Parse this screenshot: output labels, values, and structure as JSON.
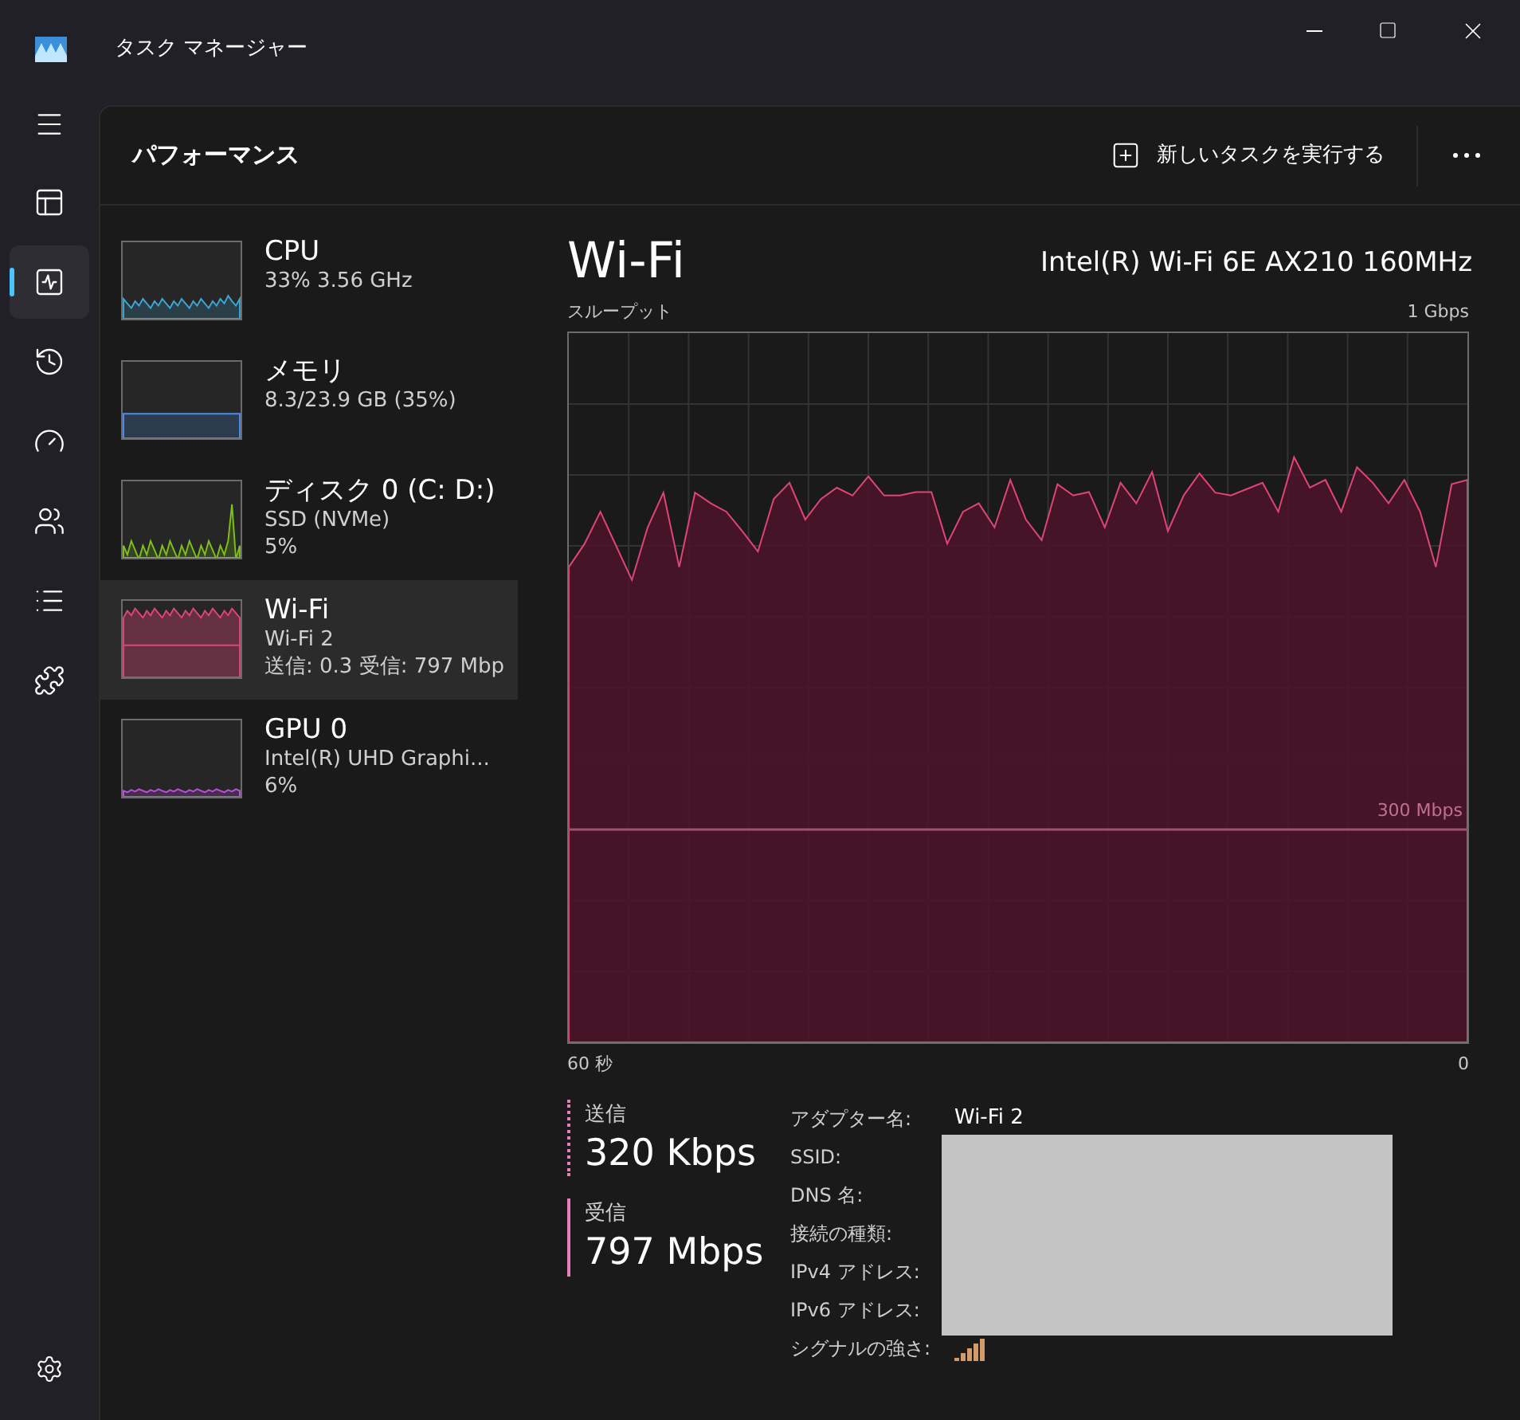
{
  "window": {
    "title": "タスク マネージャー"
  },
  "nav": [
    {
      "kind": "processes",
      "selected": false
    },
    {
      "kind": "performance",
      "selected": true
    },
    {
      "kind": "history",
      "selected": false
    },
    {
      "kind": "startup",
      "selected": false
    },
    {
      "kind": "users",
      "selected": false
    },
    {
      "kind": "details",
      "selected": false
    },
    {
      "kind": "services",
      "selected": false
    }
  ],
  "page": {
    "title": "パフォーマンス",
    "run_task": "新しいタスクを実行する"
  },
  "resources": [
    {
      "name": "CPU",
      "lines": [
        "33% 3.56 GHz"
      ],
      "color": "#3ea6d4",
      "selected": false
    },
    {
      "name": "メモリ",
      "lines": [
        "8.3/23.9 GB (35%)"
      ],
      "color": "#4a8ff0",
      "selected": false
    },
    {
      "name": "ディスク 0 (C: D:)",
      "lines": [
        "SSD (NVMe)",
        "5%"
      ],
      "color": "#7fc01a",
      "selected": false
    },
    {
      "name": "Wi-Fi",
      "lines": [
        "Wi-Fi 2",
        "送信: 0.3 受信: 797 Mbp"
      ],
      "color": "#e0447a",
      "selected": true
    },
    {
      "name": "GPU 0",
      "lines": [
        "Intel(R) UHD Graphi...",
        "6%"
      ],
      "color": "#c050e0",
      "selected": false
    }
  ],
  "detail": {
    "title": "Wi-Fi",
    "adapter": "Intel(R) Wi-Fi 6E AX210 160MHz",
    "graph": {
      "title": "スループット",
      "max_label": "1 Gbps",
      "scale_label": "300 Mbps",
      "start_label": "60 秒",
      "end_label": "0"
    },
    "stats": [
      {
        "label": "送信",
        "value": "320 Kbps",
        "kind": "send"
      },
      {
        "label": "受信",
        "value": "797 Mbps",
        "kind": "receive"
      }
    ],
    "properties": [
      {
        "label": "アダプター名:",
        "value": "Wi-Fi 2"
      },
      {
        "label": "SSID:"
      },
      {
        "label": "DNS 名:"
      },
      {
        "label": "接続の種類:"
      },
      {
        "label": "IPv4 アドレス:"
      },
      {
        "label": "IPv6 アドレス:"
      },
      {
        "label": "シグナルの強さ:",
        "kind": "signal"
      }
    ]
  }
}
